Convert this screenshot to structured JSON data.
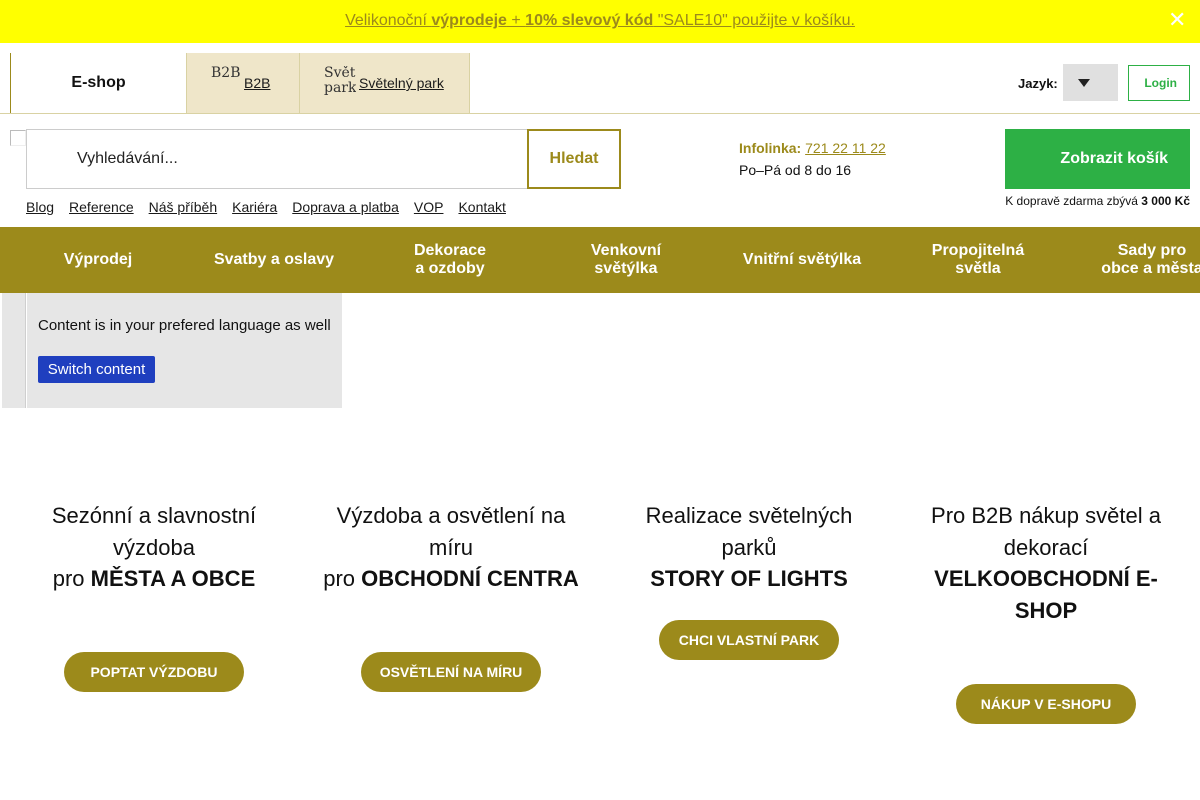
{
  "promo": {
    "part1": "Velikonoční ",
    "bold1": "výprodeje",
    "part2": " + ",
    "bold2": "10% slevový kód",
    "part3": " \"SALE10\" použijte v košíku.",
    "close": "✕"
  },
  "tabs": {
    "eshop": "E-shop",
    "b2b_img_alt": "B2B",
    "b2b": "B2B",
    "park_img_alt": "Světelný park",
    "park": "Světelný park"
  },
  "language": {
    "label": "Jazyk:"
  },
  "login": {
    "icon": "",
    "label": "Login"
  },
  "search": {
    "icon": "",
    "placeholder": "Vyhledávání...",
    "button": "Hledat"
  },
  "infoline": {
    "label": "Infolinka:",
    "phone": "721 22 11 22",
    "hours": "Po–Pá od 8 do 16"
  },
  "cart": {
    "button": "Zobrazit košík",
    "shipping_prefix": "K dopravě zdarma zbývá ",
    "shipping_amount": "3 000 Kč"
  },
  "links": [
    "Blog",
    "Reference",
    "Náš příběh",
    "Kariéra",
    "Doprava a platba",
    "VOP",
    "Kontakt"
  ],
  "nav": [
    "Výprodej",
    "Svatby a oslavy",
    "Dekorace\na ozdoby",
    "Venkovní\nsvětýlka",
    "Vnitřní světýlka",
    "Propojitelná\nsvětla",
    "Sady pro\nobce a města"
  ],
  "lang_notice": {
    "message": "Content is in your prefered language as well",
    "button": "Switch content"
  },
  "columns": [
    {
      "line1": "Sezónní a slavnostní",
      "line2": "výzdoba",
      "prefix": "pro ",
      "bold": "MĚSTA A OBCE",
      "button": "POPTAT VÝZDOBU"
    },
    {
      "line1": "Výzdoba a osvětlení na",
      "line2": "míru",
      "prefix": "pro ",
      "bold": "OBCHODNÍ CENTRA",
      "button": "OSVĚTLENÍ NA MÍRU"
    },
    {
      "line1": "Realizace světelných parků",
      "bold": "STORY OF LIGHTS",
      "button": "CHCI VLASTNÍ PARK"
    },
    {
      "line1": "Pro B2B nákup světel a",
      "line2": "dekorací",
      "bold": "VELKOOBCHODNÍ E-SHOP",
      "button": "NÁKUP V E-SHOPU"
    }
  ],
  "colors": {
    "accent": "#9c8a1b",
    "promo_bg": "#ffff00",
    "green": "#2db045",
    "blue": "#1f3fbf"
  }
}
